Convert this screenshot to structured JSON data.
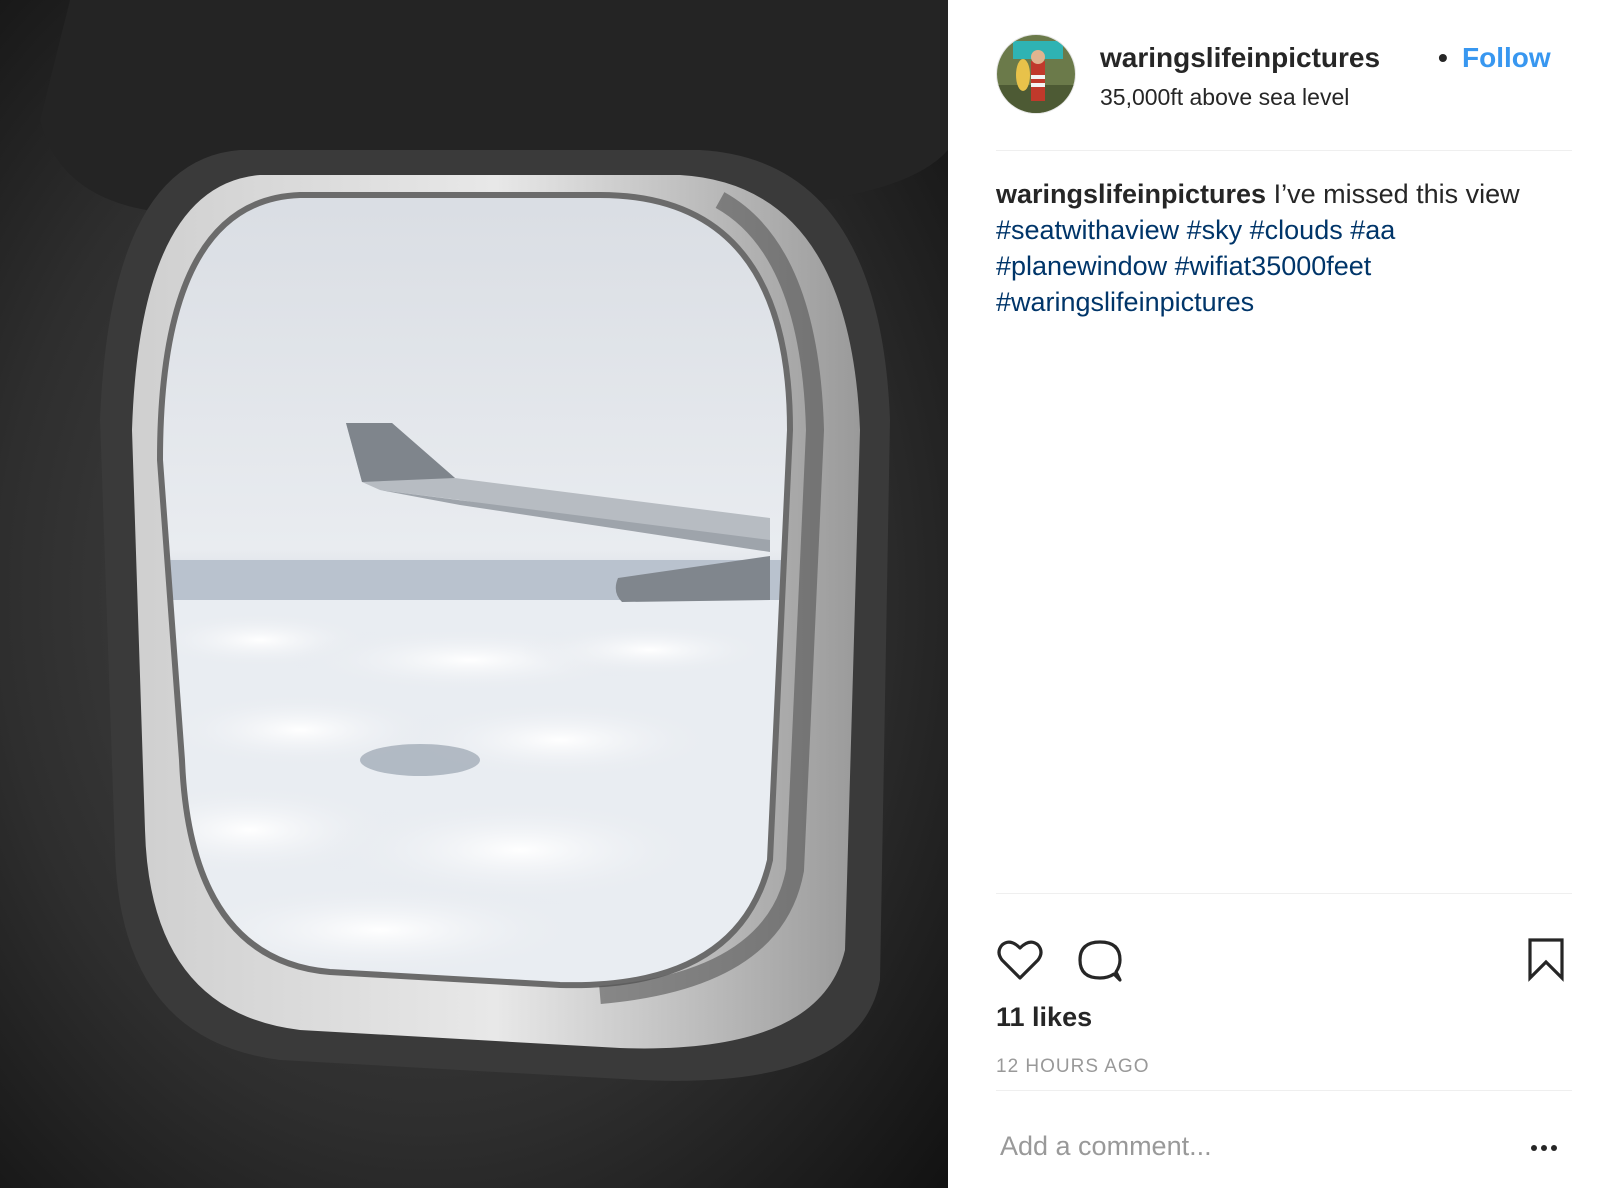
{
  "post": {
    "username": "waringslifeinpictures",
    "separator": "•",
    "follow_label": "Follow",
    "location": "35,000ft above sea level"
  },
  "caption": {
    "username": "waringslifeinpictures",
    "text": " I’ve missed this view",
    "hashtags_line1": [
      "#seatwithaview",
      "#sky",
      "#clouds",
      "#aa"
    ],
    "hashtags_line2": [
      "#planewindow",
      "#wifiat35000feet"
    ],
    "hashtags_line3": [
      "#waringslifeinpictures"
    ]
  },
  "actions": {
    "icons": [
      "heart-icon",
      "comment-icon",
      "bookmark-icon",
      "more-icon"
    ]
  },
  "likes": "11 likes",
  "timestamp": "12 HOURS AGO",
  "comment": {
    "placeholder": "Add a comment...",
    "value": ""
  },
  "colors": {
    "link_blue": "#3897f0",
    "hashtag_blue": "#003569",
    "text": "#262626",
    "muted": "#999999",
    "divider": "#efefef"
  }
}
